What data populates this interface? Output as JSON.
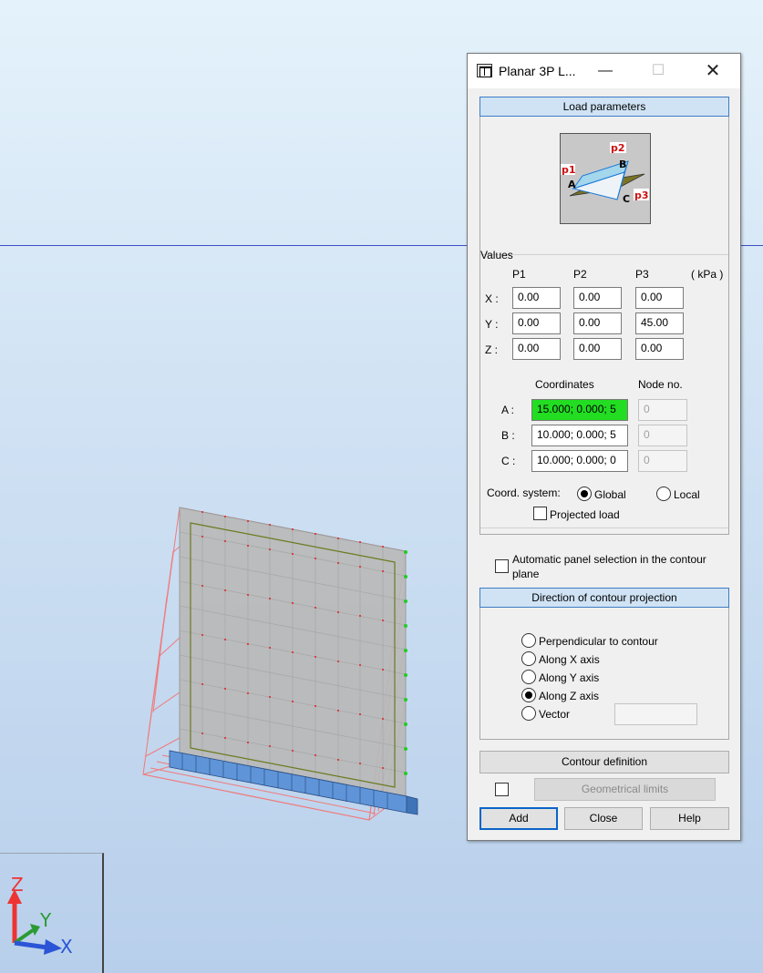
{
  "scene": {
    "axes": {
      "z_label": "Z",
      "y_label": "Y",
      "x_label": "X"
    }
  },
  "dialog": {
    "title": "Planar 3P L...",
    "window_buttons": {
      "minimize": "—",
      "maximize": "☐",
      "close": "✕"
    },
    "load_parameters": {
      "header": "Load parameters",
      "diagram_labels": {
        "p1": "p1",
        "p2": "p2",
        "p3": "p3",
        "a": "A",
        "b": "B",
        "c": "C"
      },
      "values_label": "Values",
      "columns": [
        "P1",
        "P2",
        "P3"
      ],
      "unit": "( kPa )",
      "rows": [
        {
          "label": "X :",
          "values": [
            "0.00",
            "0.00",
            "0.00"
          ]
        },
        {
          "label": "Y :",
          "values": [
            "0.00",
            "0.00",
            "45.00"
          ]
        },
        {
          "label": "Z :",
          "values": [
            "0.00",
            "0.00",
            "0.00"
          ]
        }
      ],
      "coordinates_header": "Coordinates",
      "node_header": "Node no.",
      "points": [
        {
          "label": "A :",
          "coords": "15.000; 0.000; 5",
          "node": "0",
          "highlighted": true
        },
        {
          "label": "B :",
          "coords": "10.000; 0.000; 5",
          "node": "0",
          "highlighted": false
        },
        {
          "label": "C :",
          "coords": "10.000; 0.000; 0",
          "node": "0",
          "highlighted": false
        }
      ],
      "coord_system_label": "Coord. system:",
      "coord_options": {
        "global": "Global",
        "local": "Local"
      },
      "coord_selected": "global",
      "projected_load_label": "Projected load",
      "projected_load_checked": false
    },
    "auto_panel_label_line1": "Automatic panel selection in the contour",
    "auto_panel_label_line2": "plane",
    "auto_panel_checked": false,
    "direction": {
      "header": "Direction of contour projection",
      "options": [
        "Perpendicular to contour",
        "Along X axis",
        "Along Y axis",
        "Along Z axis",
        "Vector"
      ],
      "selected_index": 3,
      "vector_value": ""
    },
    "contour_button": "Contour definition",
    "geom_limits_button": "Geometrical limits",
    "geom_limits_checked": false,
    "buttons": {
      "add": "Add",
      "close": "Close",
      "help": "Help"
    },
    "colors": {
      "highlight": "#22dd22",
      "marker": "#ffff22",
      "header_bg": "#cfe3f5",
      "header_border": "#3d7cc4"
    }
  }
}
